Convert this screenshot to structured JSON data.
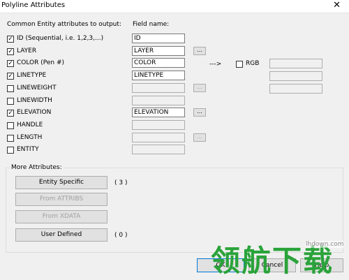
{
  "window": {
    "title": "Polyline Attributes",
    "close_glyph": "✕"
  },
  "headers": {
    "common": "Common Entity attributes to output:",
    "field_name": "Field name:"
  },
  "rows": [
    {
      "label": "ID (Sequential, i.e. 1,2,3,...)",
      "checked": true,
      "field_value": "ID",
      "field_enabled": true,
      "browse": false
    },
    {
      "label": "LAYER",
      "checked": true,
      "field_value": "LAYER",
      "field_enabled": true,
      "browse": true,
      "browse_enabled": true
    },
    {
      "label": "COLOR (Pen #)",
      "checked": true,
      "field_value": "COLOR",
      "field_enabled": true,
      "browse": false
    },
    {
      "label": "LINETYPE",
      "checked": true,
      "field_value": "LINETYPE",
      "field_enabled": true,
      "browse": false
    },
    {
      "label": "LINEWEIGHT",
      "checked": false,
      "field_value": "",
      "field_enabled": false,
      "browse": true,
      "browse_enabled": false
    },
    {
      "label": "LINEWIDTH",
      "checked": false,
      "field_value": "",
      "field_enabled": false,
      "browse": false
    },
    {
      "label": "ELEVATION",
      "checked": true,
      "field_value": "ELEVATION",
      "field_enabled": true,
      "browse": true,
      "browse_enabled": true
    },
    {
      "label": "HANDLE",
      "checked": false,
      "field_value": "",
      "field_enabled": false,
      "browse": false
    },
    {
      "label": "LENGTH",
      "checked": false,
      "field_value": "",
      "field_enabled": false,
      "browse": true,
      "browse_enabled": false
    },
    {
      "label": "ENTITY",
      "checked": false,
      "field_value": "",
      "field_enabled": false,
      "browse": false
    }
  ],
  "browse_label": "...",
  "check_glyph": "✓",
  "rgb": {
    "arrow": "--->",
    "label": "RGB",
    "checked": false,
    "fields": [
      "",
      "",
      ""
    ]
  },
  "more": {
    "title": "More Attributes:",
    "buttons": [
      {
        "label": "Entity Specific",
        "enabled": true,
        "count": "( 3 )"
      },
      {
        "label": "From ATTRIBS",
        "enabled": false,
        "count": ""
      },
      {
        "label": "From XDATA",
        "enabled": false,
        "count": ""
      },
      {
        "label": "User Defined",
        "enabled": true,
        "count": "( 0 )"
      }
    ]
  },
  "footer": {
    "ok": "OK",
    "cancel": "Cancel",
    "help": "Help"
  },
  "watermark": {
    "text": "领航下载",
    "url": "lhdown.com",
    "color": "#2aa33a"
  }
}
